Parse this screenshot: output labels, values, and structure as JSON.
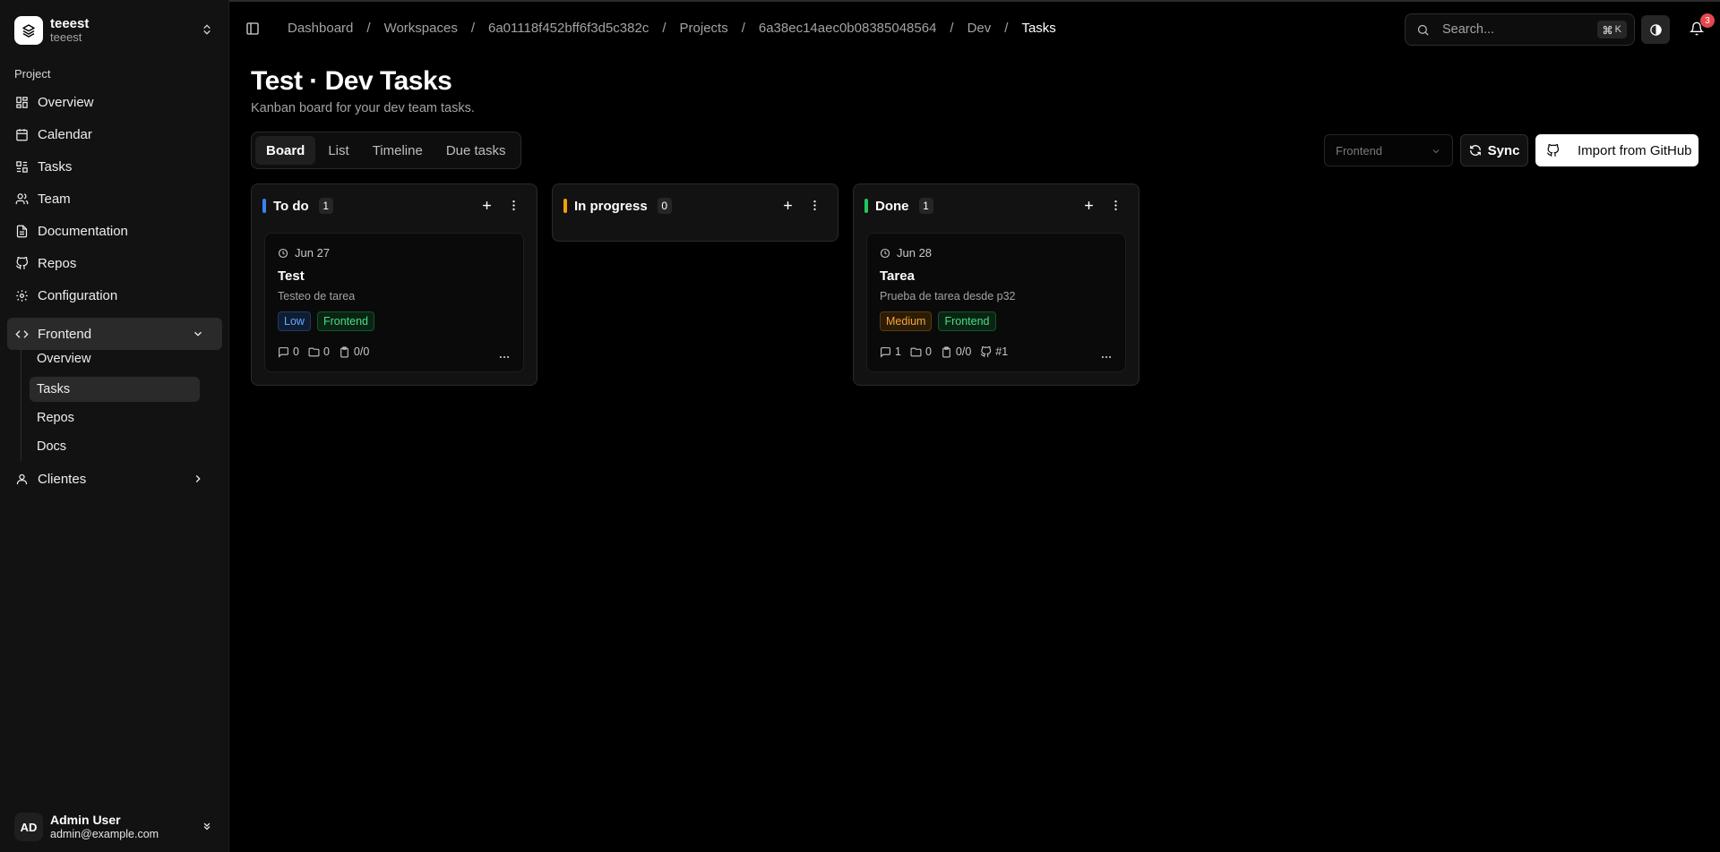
{
  "workspace": {
    "name": "teeest",
    "sub": "teeest"
  },
  "sidebar": {
    "group_label": "Project",
    "items": [
      {
        "label": "Overview",
        "icon": "dashboard-icon"
      },
      {
        "label": "Calendar",
        "icon": "calendar-icon"
      },
      {
        "label": "Tasks",
        "icon": "kanban-icon"
      },
      {
        "label": "Team",
        "icon": "users-icon"
      },
      {
        "label": "Documentation",
        "icon": "file-icon"
      },
      {
        "label": "Repos",
        "icon": "github-icon"
      },
      {
        "label": "Configuration",
        "icon": "gear-icon"
      }
    ],
    "frontend": {
      "label": "Frontend",
      "sub_items": [
        "Overview",
        "Tasks",
        "Repos",
        "Docs"
      ],
      "active_sub": "Tasks"
    },
    "clientes": {
      "label": "Clientes"
    },
    "user": {
      "initials": "AD",
      "name": "Admin User",
      "email": "admin@example.com"
    }
  },
  "header": {
    "breadcrumb": [
      "Dashboard",
      "Workspaces",
      "6a01118f452bff6f3d5c382c",
      "Projects",
      "6a38ec14aec0b08385048564",
      "Dev",
      "Tasks"
    ],
    "search_placeholder": "Search...",
    "search_shortcut_key": "K",
    "notifications_count": "3"
  },
  "page": {
    "title": "Test · Dev Tasks",
    "subtitle": "Kanban board for your dev team tasks.",
    "tabs": [
      "Board",
      "List",
      "Timeline",
      "Due tasks"
    ],
    "active_tab": "Board",
    "filter_value": "Frontend",
    "sync_label": "Sync",
    "import_label": "Import from GitHub"
  },
  "board": {
    "columns": [
      {
        "title": "To do",
        "count": "1",
        "color": "#3b82f6",
        "cards": [
          {
            "due": "Jun 27",
            "title": "Test",
            "desc": "Testeo de tarea",
            "priority": "Low",
            "tag": "Frontend",
            "comments": "0",
            "files": "0",
            "checklist": "0/0"
          }
        ]
      },
      {
        "title": "In progress",
        "count": "0",
        "color": "#f59e0b",
        "cards": []
      },
      {
        "title": "Done",
        "count": "1",
        "color": "#22c55e",
        "cards": [
          {
            "due": "Jun 28",
            "title": "Tarea",
            "desc": "Prueba de tarea desde p32",
            "priority": "Medium",
            "tag": "Frontend",
            "comments": "1",
            "files": "0",
            "checklist": "0/0",
            "pr": "#1"
          }
        ]
      }
    ]
  }
}
